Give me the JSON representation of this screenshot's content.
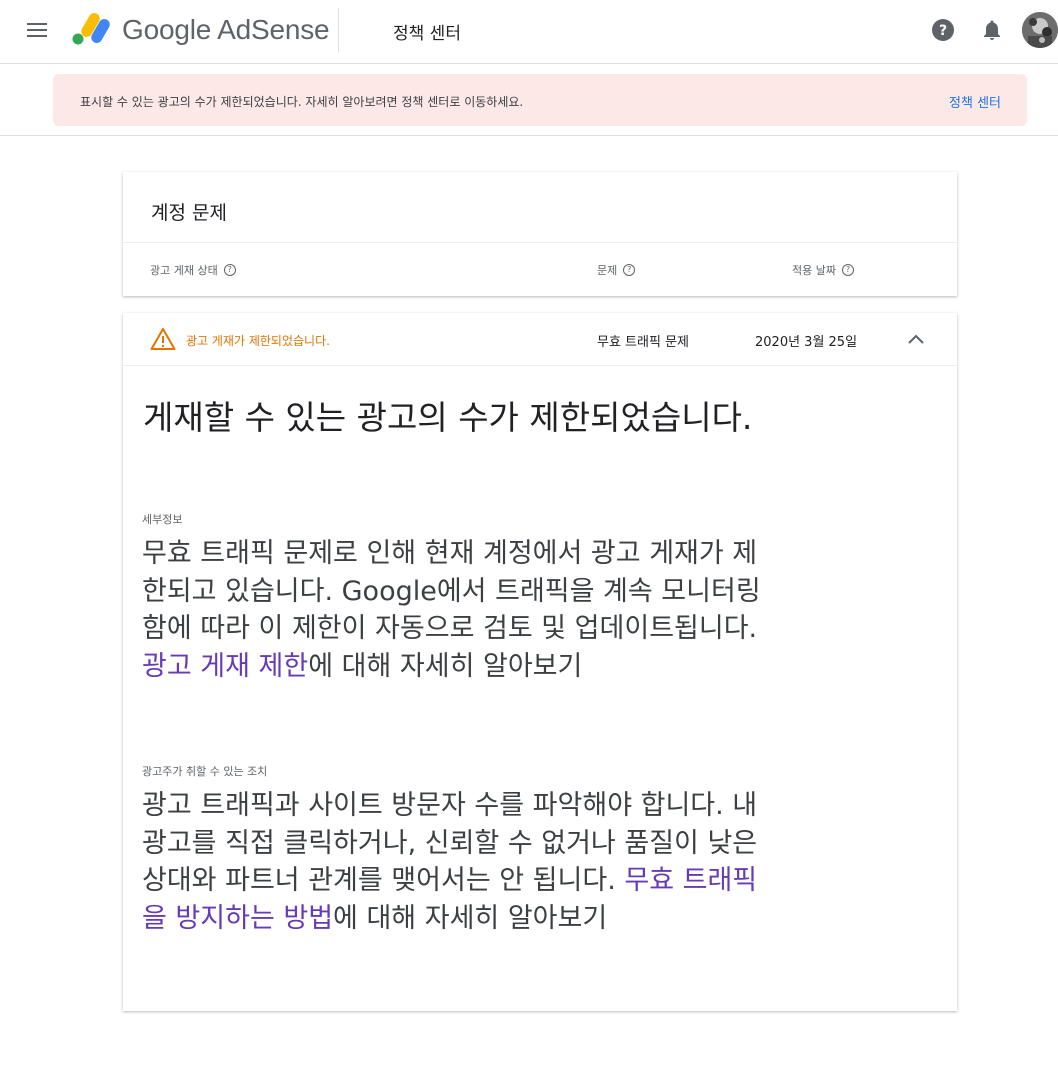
{
  "header": {
    "product_name": "Google AdSense",
    "section_title": "정책 센터",
    "icons": [
      "menu-icon",
      "help-icon",
      "notifications-icon",
      "avatar"
    ]
  },
  "banner": {
    "message": "표시할 수 있는 광고의 수가 제한되었습니다. 자세히 알아보려면 정책 센터로 이동하세요.",
    "link_label": "정책 센터"
  },
  "account_issues": {
    "title": "계정 문제",
    "columns": [
      "광고 게재 상태",
      "문제",
      "적용 날짜"
    ]
  },
  "issue_row": {
    "status": "광고 게재가 제한되었습니다.",
    "issue": "무효 트래픽 문제",
    "date": "2020년 3월 25일"
  },
  "detail": {
    "title": "게재할 수 있는 광고의 수가 제한되었습니다.",
    "details_label": "세부정보",
    "details_text": "무효 트래픽 문제로 인해 현재 계정에서 광고 게재가 제한되고 있습니다. Google에서 트래픽을 계속 모니터링함에 따라 이 제한이 자동으로 검토 및 업데이트됩니다. ",
    "details_link": "광고 게재 제한",
    "details_suffix": "에 대해 자세히 알아보기",
    "actions_label": "광고주가 취할 수 있는 조치",
    "actions_text": "광고 트래픽과 사이트 방문자 수를 파악해야 합니다. 내 광고를 직접 클릭하거나, 신뢰할 수 없거나 품질이 낮은 상대와 파트너 관계를 맺어서는 안 됩니다. ",
    "actions_link": "무효 트래픽을 방지하는 방법",
    "actions_suffix": "에 대해 자세히 알아보기"
  },
  "colors": {
    "banner_bg": "#fce8e6",
    "link_blue": "#1a73e8",
    "link_purple": "#673ab7",
    "warning": "#e37400"
  }
}
